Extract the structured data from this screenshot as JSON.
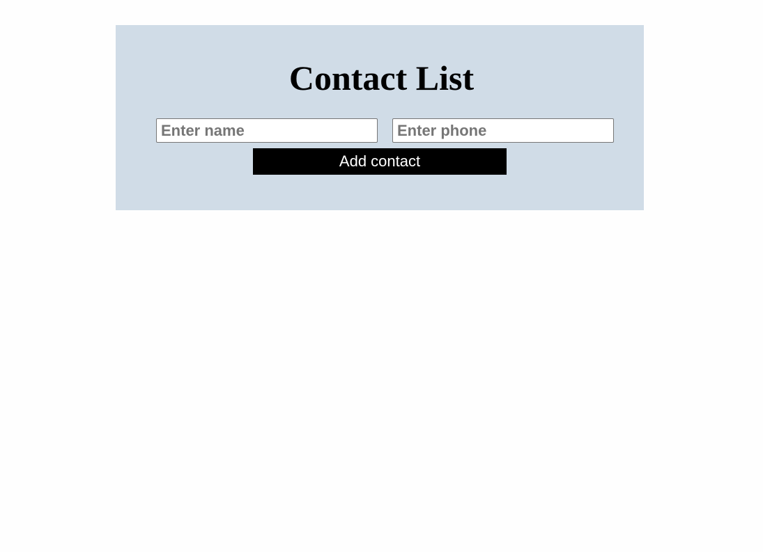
{
  "header": {
    "title": "Contact List"
  },
  "form": {
    "name_placeholder": "Enter name",
    "name_value": "",
    "phone_placeholder": "Enter phone",
    "phone_value": "",
    "add_label": "Add contact"
  },
  "colors": {
    "panel_background": "#d0dce7",
    "button_background": "#000000",
    "button_text": "#ffffff"
  }
}
